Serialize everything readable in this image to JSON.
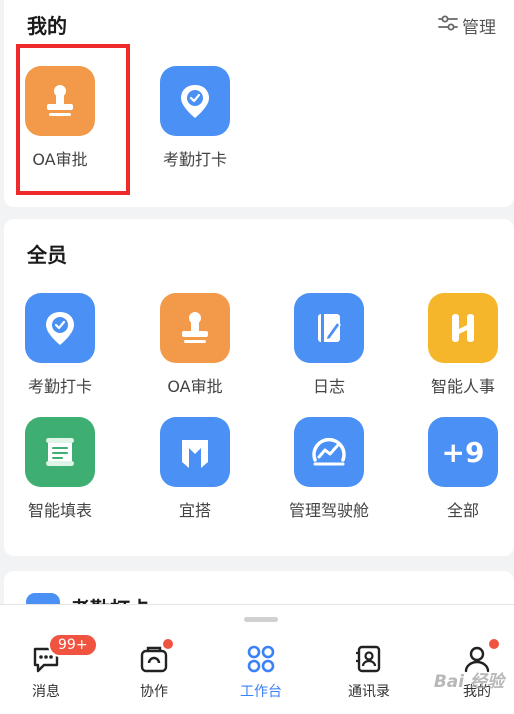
{
  "mine": {
    "title": "我的",
    "manage_label": "管理",
    "apps": [
      {
        "label": "OA审批",
        "icon": "stamp-icon",
        "color": "#f2994a"
      },
      {
        "label": "考勤打卡",
        "icon": "location-check-icon",
        "color": "#4a90f5"
      }
    ]
  },
  "all": {
    "title": "全员",
    "apps": [
      {
        "label": "考勤打卡",
        "icon": "location-check-icon",
        "color": "#4a90f5"
      },
      {
        "label": "OA审批",
        "icon": "stamp-icon",
        "color": "#f2994a"
      },
      {
        "label": "日志",
        "icon": "notebook-pen-icon",
        "color": "#4a90f5"
      },
      {
        "label": "智能人事",
        "icon": "h-logo-icon",
        "color": "#f5b62b"
      },
      {
        "label": "智能填表",
        "icon": "form-scroll-icon",
        "color": "#3fae72"
      },
      {
        "label": "宜搭",
        "icon": "yida-logo-icon",
        "color": "#4a90f5"
      },
      {
        "label": "管理驾驶舱",
        "icon": "dashboard-gauge-icon",
        "color": "#4a90f5"
      },
      {
        "label": "全部",
        "icon": "plus-nine-icon",
        "color": "#4a90f5",
        "text": "+9"
      }
    ]
  },
  "next_section": {
    "title": "考勤打卡"
  },
  "tabbar": {
    "tabs": [
      {
        "label": "消息",
        "icon": "chat-bubble-icon",
        "badge": "99+"
      },
      {
        "label": "协作",
        "icon": "collab-icon",
        "dot": true
      },
      {
        "label": "工作台",
        "icon": "workbench-grid-icon",
        "active": true
      },
      {
        "label": "通讯录",
        "icon": "contacts-book-icon"
      },
      {
        "label": "我的",
        "icon": "profile-icon",
        "dot": true
      }
    ]
  },
  "watermark": "Bai 经验",
  "colors": {
    "accent": "#3b82f6",
    "badge": "#f0533f",
    "highlight": "#ee2a2a"
  }
}
